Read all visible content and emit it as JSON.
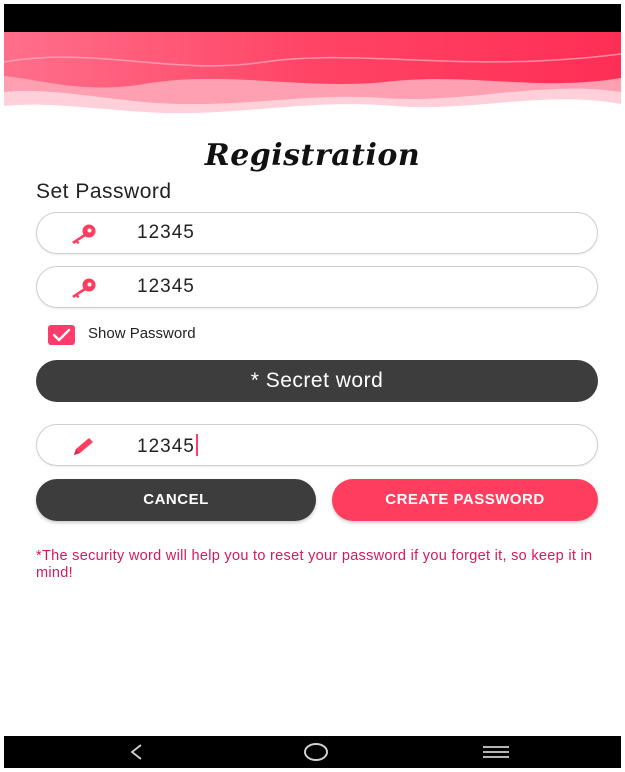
{
  "app": {
    "title": "Registration",
    "subtitle": "Set Password"
  },
  "password_field": {
    "value": "12345",
    "icon": "key-icon"
  },
  "confirm_password_field": {
    "value": "12345",
    "icon": "key-icon"
  },
  "show_password": {
    "label": "Show Password",
    "checked": true
  },
  "secret_word_header": {
    "label": "* Secret word"
  },
  "secret_word_field": {
    "value": "12345",
    "icon": "pencil-icon"
  },
  "buttons": {
    "cancel_label": "CANCEL",
    "create_label": "CREATE PASSWORD"
  },
  "note": {
    "text": "*The security word will help you to reset your password if you forget it, so keep it in mind!"
  },
  "navigation": {
    "back": "back-icon",
    "home": "home-icon",
    "menu": "menu-icon"
  },
  "colors": {
    "accent": "#ff3d5f",
    "dark_button": "#3d3d3d",
    "note_text": "#d6195d"
  }
}
